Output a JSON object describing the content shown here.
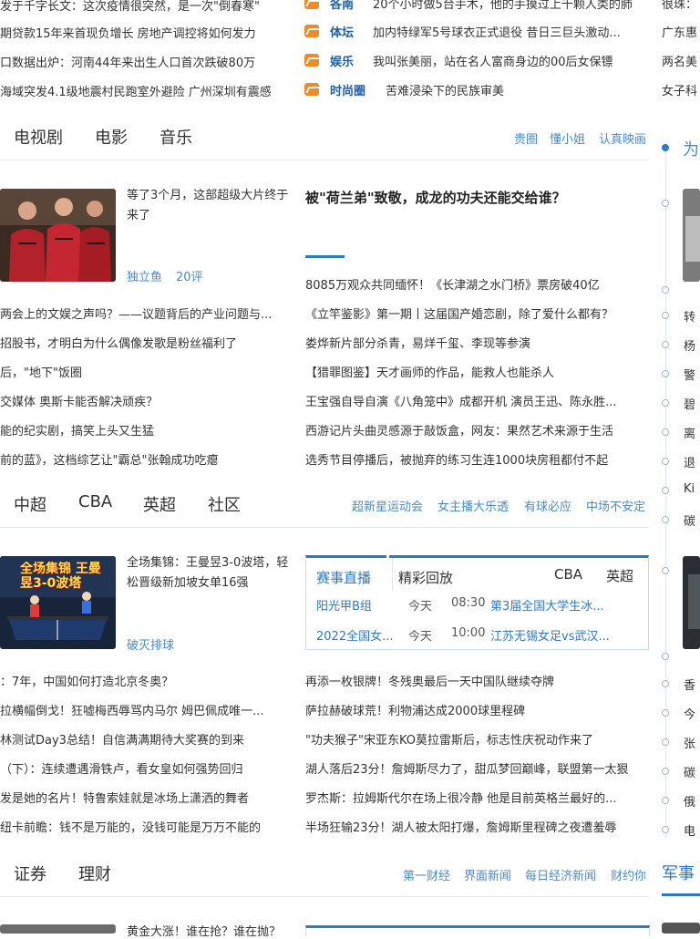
{
  "top_news": {
    "left": [
      "发于千字长文：这次疫情很突然，是一次\"倒春寒\"",
      "期贷款15年来首现负增长 房地产调控将如何发力",
      "口数据出炉：河南44年来出生人口首次跌破80万",
      "海域突发4.1级地震村民跑室外避险 广州深圳有震感"
    ],
    "middle": [
      {
        "tag": "各南",
        "text": "20个小时做5台手术，他的手摸过上千颗人类的肺"
      },
      {
        "tag": "体坛",
        "text": "加内特绿军5号球衣正式退役 昔日三巨头激动..."
      },
      {
        "tag": "娱乐",
        "text": "我叫张美丽，站在名人富商身边的00后女保镖"
      },
      {
        "tag": "时尚圈",
        "text": "苦难浸染下的民族审美"
      }
    ],
    "right": [
      "很珠：",
      "广东惠",
      "两名美",
      "女子科"
    ]
  },
  "entertainment": {
    "tabs": [
      "电视剧",
      "电影",
      "音乐"
    ],
    "links": [
      "贵圈",
      "懂小姐",
      "认真映画"
    ],
    "feature": {
      "caption": "等了3个月，这部超级大片终于来了",
      "source": "独立鱼",
      "comments": "20评"
    },
    "headline": "被\"荷兰弟\"致敬，成龙的功夫还能交给谁？",
    "left_list": [
      "两会上的文娱之声吗？——议题背后的产业问题与...",
      "招股书，才明白为什么偶像发歌是粉丝福利了",
      "后，\"地下\"饭圈",
      "交媒体 奥斯卡能否解决顽疾？",
      "能的纪实剧，搞笑上头又生猛",
      "前的蓝》，这档综艺让\"霸总\"张翰成功吃瘪"
    ],
    "right_list": [
      "8085万观众共同缅怀！《长津湖之水门桥》票房破40亿",
      "《立竿鉴影》第一期丨这届国产婚恋剧，除了爱什么都有？",
      "娄烨新片部分杀青，易烊千玺、李现等参演",
      "【猎罪图鉴】天才画师的作品，能救人也能杀人",
      "王宝强自导自演《八角笼中》成都开机 演员王迅、陈永胜...",
      "西游记片头曲灵感源于敲饭盒，网友：果然艺术来源于生活",
      "选秀节目停播后，被抛弃的练习生连1000块房租都付不起"
    ]
  },
  "sports": {
    "tabs": [
      "中超",
      "CBA",
      "英超",
      "社区"
    ],
    "links": [
      "超新星运动会",
      "女主播大乐透",
      "有球必应",
      "中场不安定"
    ],
    "feature": {
      "caption": "全场集锦：王曼昱3-0波塔，轻松晋级新加坡女单16强",
      "source": "破灭排球",
      "thumb_text": "全场集锦 王曼昱3-0波塔"
    },
    "live": {
      "tabs": [
        "赛事直播",
        "精彩回放"
      ],
      "extra_tabs": [
        "CBA",
        "英超"
      ],
      "rows": [
        {
          "name": "阳光甲B组",
          "day": "今天",
          "time": "08:30",
          "title": "第3届全国大学生冰..."
        },
        {
          "name": "2022全国女...",
          "day": "今天",
          "time": "10:00",
          "title": "江苏无锡女足vs武汉..."
        }
      ]
    },
    "left_list": [
      "：7年，中国如何打造北京冬奥？",
      "拉横幅倒戈！狂嘘梅西辱骂内马尔 姆巴佩成唯一...",
      "林测试Day3总结！自信满满期待大奖赛的到来",
      "（下）：连续遭遇滑铁卢，看女皇如何强势回归",
      "发是她的名片！特鲁索娃就是冰场上潇洒的舞者",
      "纽卡前瞻：钱不是万能的，没钱可能是万万不能的"
    ],
    "right_list": [
      "再添一枚银牌！冬残奥最后一天中国队继续夺牌",
      "萨拉赫破球荒！利物浦达成2000球里程碑",
      "\"功夫猴子\"宋亚东KO莫拉雷斯后，标志性庆祝动作来了",
      "湖人落后23分！詹姆斯尽力了，甜瓜梦回巅峰，联盟第一太狠",
      "罗杰斯：拉姆斯代尔在场上很冷静 他是目前英格兰最好的...",
      "半场狂输23分！湖人被太阳打爆，詹姆斯里程碑之夜遭羞辱"
    ]
  },
  "finance": {
    "tabs": [
      "证券",
      "理财"
    ],
    "links": [
      "第一财经",
      "界面新闻",
      "每日经济新闻",
      "财约你"
    ],
    "feature_caption": "黄金大涨！谁在抢？谁在抛？"
  },
  "sidebar": {
    "title_fragment": "为",
    "list1": [
      "转",
      "杨",
      "警",
      "碧",
      "离",
      "退",
      "Ki",
      "碳"
    ],
    "list2": [
      "香",
      "今",
      "张",
      "碳",
      "俄",
      "电"
    ],
    "military_title": "军事"
  },
  "colors": {
    "accent": "#2c7bc9",
    "link": "#4a8bc9",
    "tag": "#1f5fa8",
    "icon": "#f08a24"
  }
}
